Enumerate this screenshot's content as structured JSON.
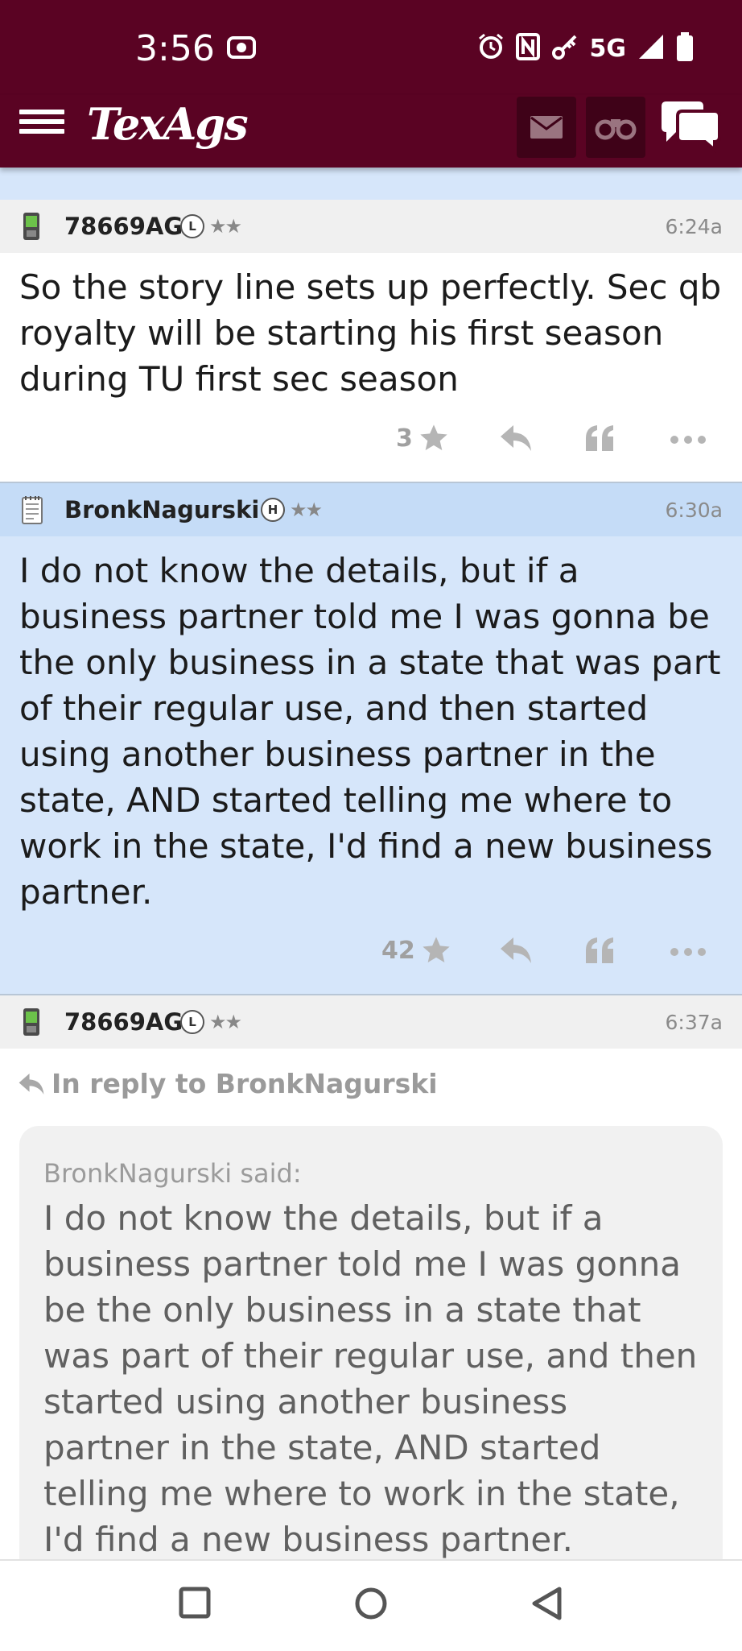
{
  "status_bar": {
    "time": "3:56",
    "network": "5G"
  },
  "app": {
    "logo": "TexAgs"
  },
  "posts": [
    {
      "username": "78669AG",
      "badge": "L",
      "stars": "★★",
      "time": "6:24a",
      "body": "So the story line sets up perfectly. Sec qb royalty will be starting his first season during TU first sec season",
      "star_count": "3"
    },
    {
      "username": "BronkNagurski",
      "badge": "H",
      "stars": "★★",
      "time": "6:30a",
      "body": "I do not know the details, but if a business partner told me I was gonna be the only business in a state that was part of their regular use, and then started using another business partner in the state, AND started telling me where to work in the state, I'd find a new business partner.",
      "star_count": "42"
    },
    {
      "username": "78669AG",
      "badge": "L",
      "stars": "★★",
      "time": "6:37a",
      "reply_to": "In reply to BronkNagurski",
      "quote_author": "BronkNagurski said:",
      "quote_text": "I do not know the details, but if a business partner told me I was gonna be the only business in a state that was part of their regular use, and then started using another business partner in the state, AND started telling me where to work in the state, I'd find a new business partner."
    }
  ],
  "icons": {
    "nav": [
      "menu-icon",
      "mail-icon",
      "binoculars-icon",
      "chat-icon"
    ],
    "post_actions": [
      "star-icon",
      "reply-icon",
      "quote-icon",
      "more-icon"
    ],
    "system": [
      "recents-icon",
      "home-icon",
      "back-icon"
    ]
  },
  "colors": {
    "brand": "#5a0323",
    "brand_dark": "#3f0218",
    "highlight_post": "#d6e6fa",
    "highlight_header": "#c5dcf7"
  }
}
